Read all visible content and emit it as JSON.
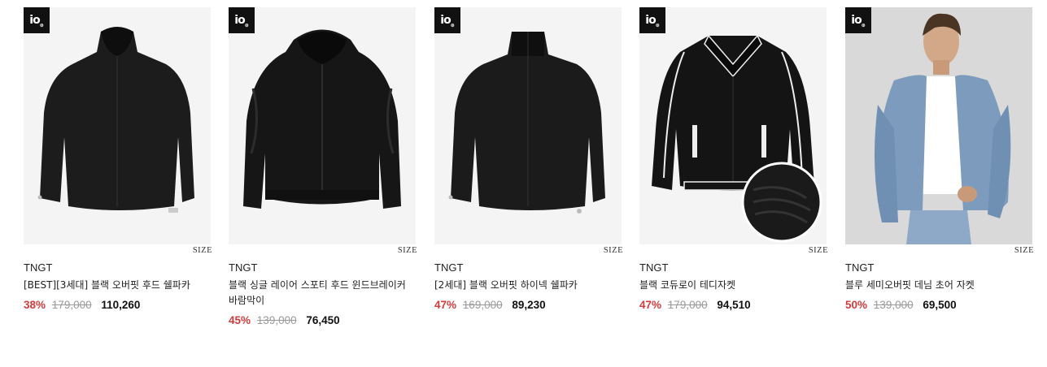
{
  "badge_text": "io",
  "products": [
    {
      "brand": "TNGT",
      "title": "[BEST][3세대] 블랙 오버핏 후드 쉘파카",
      "discount": "38%",
      "original_price": "179,000",
      "sale_price": "110,260",
      "size_label": "SIZE",
      "image": "black-hooded-shell-jacket"
    },
    {
      "brand": "TNGT",
      "title": "블랙 싱글 레이어 스포티 후드 윈드브레이커 바람막이",
      "discount": "45%",
      "original_price": "139,000",
      "sale_price": "76,450",
      "size_label": "SIZE",
      "image": "black-windbreaker"
    },
    {
      "brand": "TNGT",
      "title": "[2세대] 블랙 오버핏 하이넥 쉘파카",
      "discount": "47%",
      "original_price": "169,000",
      "sale_price": "89,230",
      "size_label": "SIZE",
      "image": "black-highneck-shell-jacket"
    },
    {
      "brand": "TNGT",
      "title": "블랙 코듀로이 테디자켓",
      "discount": "47%",
      "original_price": "179,000",
      "sale_price": "94,510",
      "size_label": "SIZE",
      "image": "black-corduroy-teddy-jacket"
    },
    {
      "brand": "TNGT",
      "title": "블루 세미오버핏 데님 초어 자켓",
      "discount": "50%",
      "original_price": "139,000",
      "sale_price": "69,500",
      "size_label": "SIZE",
      "image": "blue-denim-chore-jacket-model"
    }
  ]
}
